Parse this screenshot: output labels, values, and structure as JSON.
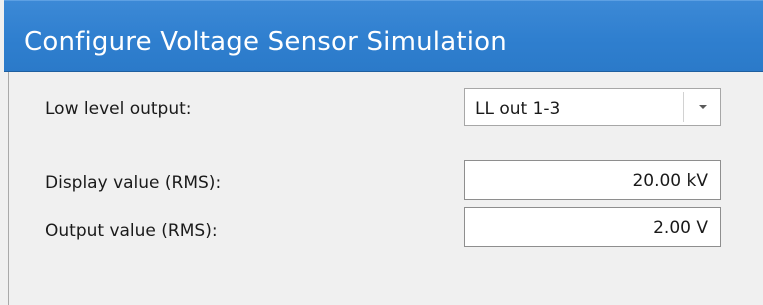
{
  "dialog": {
    "title": "Configure Voltage Sensor Simulation"
  },
  "form": {
    "low_level_output": {
      "label": "Low level output:",
      "selected": "LL out 1-3"
    },
    "display_value": {
      "label": "Display value (RMS):",
      "value": "20.00 kV"
    },
    "output_value": {
      "label": "Output value (RMS):",
      "value": "2.00 V"
    }
  },
  "icons": {
    "dropdown": "chevron-down-icon"
  },
  "colors": {
    "title_bar": "#2f7fcf",
    "title_text": "#ffffff",
    "background": "#f0f0f0"
  }
}
